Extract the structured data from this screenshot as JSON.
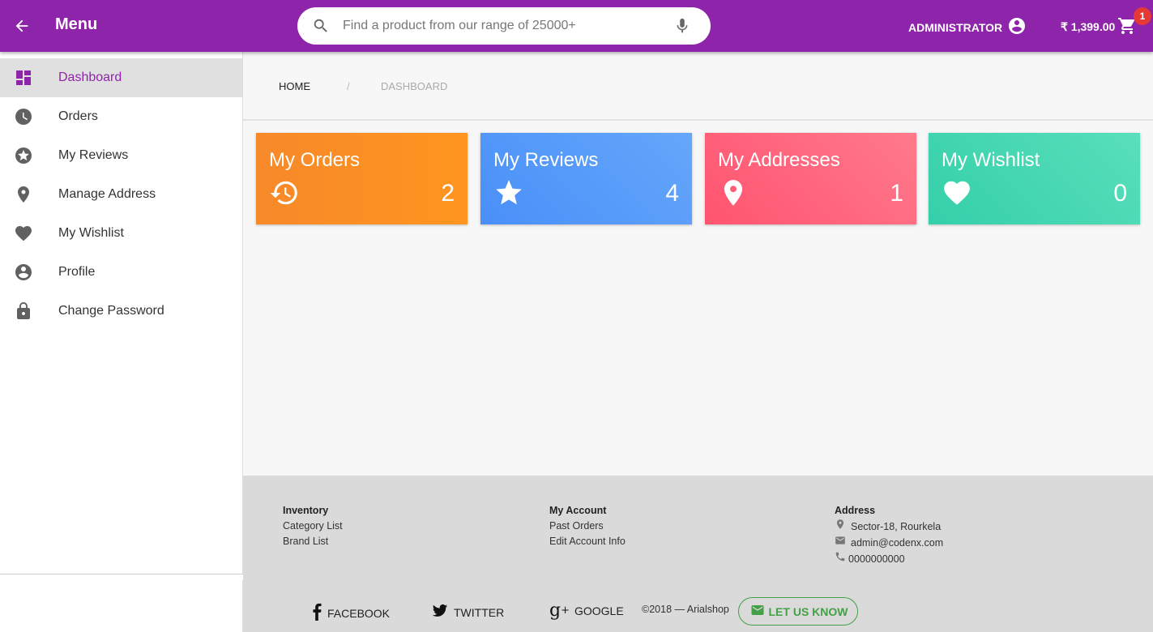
{
  "header": {
    "menu_title": "Menu",
    "search_placeholder": "Find a product from our range of 25000+",
    "user_label": "ADMINISTRATOR",
    "cart_total": "₹ 1,399.00",
    "cart_count": "1",
    "brand_color": "#8e24aa"
  },
  "sidebar": {
    "items": [
      {
        "label": "Dashboard",
        "icon": "dashboard-icon",
        "active": true
      },
      {
        "label": "Orders",
        "icon": "clock-icon"
      },
      {
        "label": "My Reviews",
        "icon": "star-circle-icon"
      },
      {
        "label": "Manage Address",
        "icon": "location-pin-icon"
      },
      {
        "label": "My Wishlist",
        "icon": "heart-icon"
      },
      {
        "label": "Profile",
        "icon": "account-circle-icon"
      },
      {
        "label": "Change Password",
        "icon": "lock-icon"
      }
    ]
  },
  "breadcrumb": {
    "home": "HOME",
    "separator": "/",
    "current": "DASHBOARD"
  },
  "cards": [
    {
      "title": "My Orders",
      "value": "2",
      "icon": "history-icon",
      "color": "#f7892a"
    },
    {
      "title": "My Reviews",
      "value": "4",
      "icon": "star-icon",
      "color": "#4a8ff8"
    },
    {
      "title": "My Addresses",
      "value": "1",
      "icon": "location-pin-icon",
      "color": "#ff5470"
    },
    {
      "title": "My Wishlist",
      "value": "0",
      "icon": "heart-icon",
      "color": "#34d0a9"
    }
  ],
  "footer": {
    "inventory": {
      "heading": "Inventory",
      "links": [
        "Category List",
        "Brand List"
      ]
    },
    "account": {
      "heading": "My Account",
      "links": [
        "Past Orders",
        "Edit Account Info"
      ]
    },
    "address": {
      "heading": "Address",
      "location": "Sector-18, Rourkela",
      "email": "admin@codenx.com",
      "phone": "0000000000"
    },
    "social": {
      "facebook": "FACEBOOK",
      "twitter": "TWITTER",
      "google": "GOOGLE"
    },
    "copyright": "©2018 — Arialshop",
    "feedback_label": "LET US KNOW"
  }
}
